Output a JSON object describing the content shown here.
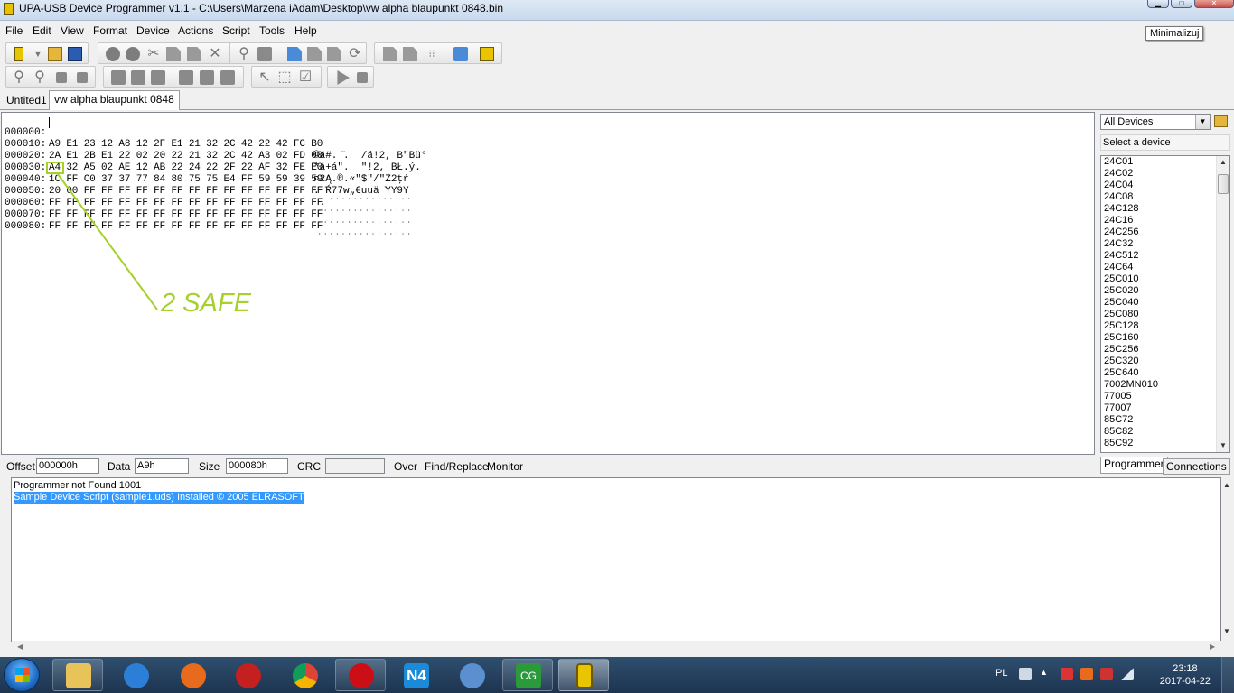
{
  "window": {
    "title": "UPA-USB Device Programmer v1.1  - C:\\Users\\Marzena iAdam\\Desktop\\vw alpha blaupunkt 0848.bin",
    "tooltip": "Minimalizuj"
  },
  "menu": [
    "File",
    "Edit",
    "View",
    "Format",
    "Device",
    "Actions",
    "Script",
    "Tools",
    "Help"
  ],
  "tabs": {
    "untitled": "Untited1",
    "active": "vw alpha blaupunkt 0848"
  },
  "hex": {
    "rows": [
      {
        "addr": "000000:",
        "hex": "A9 E1 23 12 A8 12 2F E1 21 32 2C 42 22 42 FC B0",
        "ascii": "©á#. ̈.  /á!2, B\"Bü°"
      },
      {
        "addr": "000010:",
        "hex": "2A E1 2B E1 22 02 20 22 21 32 2C 42 A3 02 FD 00",
        "ascii": "*á+á\".  \"!2, BŁ.ý."
      },
      {
        "addr": "000020:",
        "hex": "A4 32 A5 02 AE 12 AB 22 24 22 2F 22 AF 32 FE E0",
        "ascii": "¤2Ą.®.«\"$\"/\"Ż2ţŕ"
      },
      {
        "addr": "000030:",
        "hex": "1C FF C0 37 37 77 84 80 75 75 E4 FF 59 59 39 59",
        "ascii": ". ̇Ŕ77w„€uuä ̇YY9Y"
      },
      {
        "addr": "000040:",
        "hex": "20 00 FF FF FF FF FF FF FF FF FF FF FF FF FF FF",
        "ascii": " . ̇ ̇ ̇ ̇ ̇ ̇ ̇ ̇ ̇ ̇ ̇ ̇ ̇ ̇"
      },
      {
        "addr": "000050:",
        "hex": "FF FF FF FF FF FF FF FF FF FF FF FF FF FF FF FF",
        "ascii": " ̇ ̇ ̇ ̇ ̇ ̇ ̇ ̇ ̇ ̇ ̇ ̇ ̇ ̇ ̇ ̇"
      },
      {
        "addr": "000060:",
        "hex": "FF FF FF FF FF FF FF FF FF FF FF FF FF FF FF FF",
        "ascii": " ̇ ̇ ̇ ̇ ̇ ̇ ̇ ̇ ̇ ̇ ̇ ̇ ̇ ̇ ̇ ̇"
      },
      {
        "addr": "000070:",
        "hex": "FF FF FF FF FF FF FF FF FF FF FF FF FF FF FF FF",
        "ascii": " ̇ ̇ ̇ ̇ ̇ ̇ ̇ ̇ ̇ ̇ ̇ ̇ ̇ ̇ ̇ ̇"
      },
      {
        "addr": "000080:",
        "hex": "",
        "ascii": ""
      }
    ],
    "annotation": "2 SAFE",
    "annotation_color": "#a6d12b"
  },
  "devices": {
    "filter": "All Devices",
    "prompt": "Select a device",
    "items": [
      "24C01",
      "24C02",
      "24C04",
      "24C08",
      "24C128",
      "24C16",
      "24C256",
      "24C32",
      "24C512",
      "24C64",
      "25C010",
      "25C020",
      "25C040",
      "25C080",
      "25C128",
      "25C160",
      "25C256",
      "25C320",
      "25C640",
      "7002MN010",
      "77005",
      "77007",
      "85C72",
      "85C82",
      "85C92"
    ]
  },
  "status": {
    "offset_label": "Offset",
    "offset_value": "000000h",
    "data_label": "Data",
    "data_value": "A9h",
    "size_label": "Size",
    "size_value": "000080h",
    "crc_label": "CRC",
    "crc_value": "",
    "over_label": "Over",
    "find_label": "Find/Replace",
    "monitor_label": "Monitor"
  },
  "bottom_tabs": {
    "programmer": "Programmer",
    "connections": "Connections"
  },
  "log": [
    {
      "text": "Programmer not Found 1001",
      "selected": false
    },
    {
      "text": "Sample Device Script (sample1.uds) Installed © 2005 ELRASOFT",
      "selected": true
    }
  ],
  "taskbar": {
    "apps": [
      {
        "name": "explorer",
        "color": "#e8c35a"
      },
      {
        "name": "internet-explorer",
        "color": "#2b7fd6"
      },
      {
        "name": "firefox",
        "color": "#e86a1c"
      },
      {
        "name": "media-player",
        "color": "#c42020"
      },
      {
        "name": "chrome",
        "color": "#3cba54"
      },
      {
        "name": "opera",
        "color": "#cc0f16"
      },
      {
        "name": "n4",
        "color": "#1b8ad8",
        "label": "N4"
      },
      {
        "name": "paint",
        "color": "#5a8fd0"
      },
      {
        "name": "cg",
        "color": "#2a9a3a",
        "label": "CG"
      },
      {
        "name": "upa-programmer",
        "color": "#e9c400"
      }
    ],
    "lang": "PL",
    "time": "23:18",
    "date": "2017-04-22"
  }
}
